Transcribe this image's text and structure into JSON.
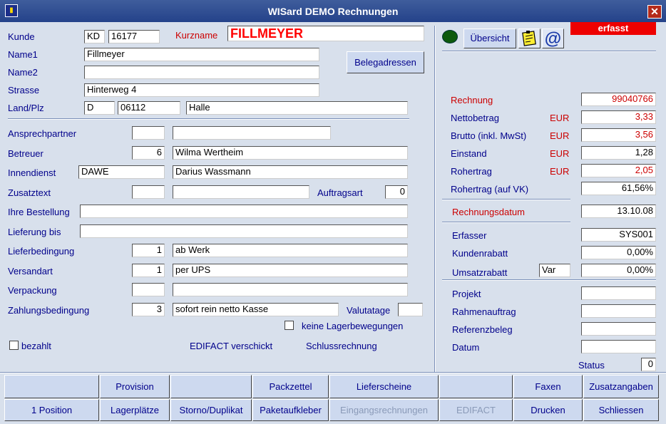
{
  "window": {
    "title": "WISard DEMO Rechnungen"
  },
  "header": {
    "kunde_label": "Kunde",
    "kunde_prefix": "KD",
    "kunde_nr": "16177",
    "kurzname_label": "Kurzname",
    "kurzname": "FILLMEYER"
  },
  "address": {
    "name1_label": "Name1",
    "name1": "Fillmeyer",
    "name2_label": "Name2",
    "name2": "",
    "strasse_label": "Strasse",
    "strasse": "Hinterweg 4",
    "landplz_label": "Land/Plz",
    "land": "D",
    "plz": "06112",
    "ort": "Halle",
    "belegadressen_button": "Belegadressen"
  },
  "details": {
    "ansprechpartner_label": "Ansprechpartner",
    "ansprechpartner_code": "",
    "ansprechpartner_name": "",
    "betreuer_label": "Betreuer",
    "betreuer_code": "6",
    "betreuer_name": "Wilma Wertheim",
    "innendienst_label": "Innendienst",
    "innendienst_code": "DAWE",
    "innendienst_name": "Darius Wassmann",
    "zusatztext_label": "Zusatztext",
    "zusatztext_code": "",
    "zusatztext_value": "",
    "auftragsart_label": "Auftragsart",
    "auftragsart": "0",
    "ihre_bestellung_label": "Ihre Bestellung",
    "ihre_bestellung": "",
    "lieferung_bis_label": "Lieferung bis",
    "lieferung_bis": "",
    "lieferbedingung_label": "Lieferbedingung",
    "lieferbedingung_code": "1",
    "lieferbedingung": "ab Werk",
    "versandart_label": "Versandart",
    "versandart_code": "1",
    "versandart": "per UPS",
    "verpackung_label": "Verpackung",
    "verpackung_code": "",
    "verpackung": "",
    "zahlungsbedingung_label": "Zahlungsbedingung",
    "zahlungsbedingung_code": "3",
    "zahlungsbedingung": "sofort rein netto Kasse",
    "valutatage_label": "Valutatage",
    "valutatage": "",
    "keine_lagerbewegungen_label": "keine Lagerbewegungen",
    "bezahlt_label": "bezahlt",
    "edifact_verschickt": "EDIFACT verschickt",
    "schlussrechnung": "Schlussrechnung"
  },
  "right": {
    "uebersicht_button": "Übersicht",
    "status_badge": "erfasst",
    "rechnung_label": "Rechnung",
    "rechnung": "99040766",
    "nettobetrag_label": "Nettobetrag",
    "nettobetrag": "3,33",
    "brutto_label": "Brutto (inkl. MwSt)",
    "brutto": "3,56",
    "einstand_label": "Einstand",
    "einstand": "1,28",
    "rohertrag_label": "Rohertrag",
    "rohertrag": "2,05",
    "rohertrag_vk_label": "Rohertrag (auf VK)",
    "rohertrag_vk": "61,56%",
    "currency": "EUR",
    "rechnungsdatum_label": "Rechnungsdatum",
    "rechnungsdatum": "13.10.08",
    "erfasser_label": "Erfasser",
    "erfasser": "SYS001",
    "kundenrabatt_label": "Kundenrabatt",
    "kundenrabatt": "0,00%",
    "umsatzrabatt_label": "Umsatzrabatt",
    "umsatzrabatt_type": "Var",
    "umsatzrabatt": "0,00%",
    "projekt_label": "Projekt",
    "projekt": "",
    "rahmenauftrag_label": "Rahmenauftrag",
    "rahmenauftrag": "",
    "referenzbeleg_label": "Referenzbeleg",
    "referenzbeleg": "",
    "datum_label": "Datum",
    "datum": "",
    "status_label": "Status",
    "status": "0"
  },
  "toolbar": {
    "row1": [
      "",
      "Provision",
      "",
      "Packzettel",
      "Lieferscheine",
      "",
      "Faxen",
      "Zusatzangaben"
    ],
    "row2": [
      "1 Position",
      "Lagerplätze",
      "Storno/Duplikat",
      "Paketaufkleber",
      "Eingangsrechnungen",
      "EDIFACT",
      "Drucken",
      "Schliessen"
    ]
  },
  "colors": {
    "title_bar": "#24428a",
    "background": "#d8e0ec",
    "label": "#00008b",
    "accent_red": "#cc0000"
  }
}
